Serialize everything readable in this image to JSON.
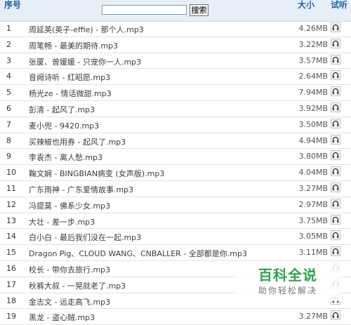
{
  "header": {
    "number_label": "序号",
    "size_label": "大小",
    "listen_label": "试听",
    "search_value": "",
    "search_button": "搜索"
  },
  "songs": [
    {
      "num": "1",
      "title": "周延英(英子-effie) - 那个人.mp3",
      "size": "4.26MB"
    },
    {
      "num": "2",
      "title": "周笔畅 - 最美的期待.mp3",
      "size": "3.22MB"
    },
    {
      "num": "3",
      "title": "张厦、曾媛媛 - 只宠你一人.mp3",
      "size": "3.57MB"
    },
    {
      "num": "4",
      "title": "音阙诗听 - 红昭愿.mp3",
      "size": "2.64MB"
    },
    {
      "num": "5",
      "title": "杨光ze - 情话微甜.mp3",
      "size": "7.94MB"
    },
    {
      "num": "6",
      "title": "彭清 - 起风了.mp3",
      "size": "3.92MB"
    },
    {
      "num": "7",
      "title": "麦小兜 - 9420.mp3",
      "size": "3.50MB"
    },
    {
      "num": "8",
      "title": "买辣椒也用券 - 起风了.mp3",
      "size": "4.94MB"
    },
    {
      "num": "9",
      "title": "李袁杰 - 离人愁.mp3",
      "size": "3.80MB"
    },
    {
      "num": "10",
      "title": "鞠文娴 - BINGBIAN病变 (女声版).mp3",
      "size": "4.04MB"
    },
    {
      "num": "11",
      "title": "广东雨神 - 广东爱情故事.mp3",
      "size": "3.27MB"
    },
    {
      "num": "12",
      "title": "冯提莫 - 佛系少女.mp3",
      "size": "2.97MB"
    },
    {
      "num": "13",
      "title": "大壮 - 差一步.mp3",
      "size": "3.75MB"
    },
    {
      "num": "14",
      "title": "白小白 - 最后我们没在一起.mp3",
      "size": "3.05MB"
    },
    {
      "num": "15",
      "title": "Dragon Pig、CLOUD WANG、CNBALLER - 全部都是你.mp3",
      "size": "3.11MB"
    },
    {
      "num": "16",
      "title": "校长 - 带你去旅行.mp3",
      "size": ""
    },
    {
      "num": "17",
      "title": "秋裤大叔 - 一晃就老了.mp3",
      "size": ""
    },
    {
      "num": "18",
      "title": "金志文 - 远走高飞.mp3",
      "size": ""
    },
    {
      "num": "19",
      "title": "黑龙 - 盗心贼.mp3",
      "size": "3.27MB"
    }
  ],
  "icons": {
    "listen": "headphones-icon"
  },
  "colors": {
    "header_bg": "#e6eef7",
    "header_text": "#1f63a8",
    "watermark_green": "#2ea44f"
  },
  "watermark": {
    "title": "百科全说",
    "subtitle": "助你轻松解决"
  }
}
